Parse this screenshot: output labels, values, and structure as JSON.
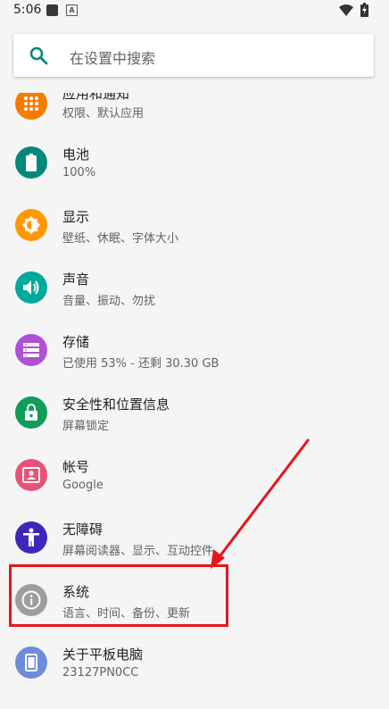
{
  "status": {
    "time": "5:06",
    "a_label": "A"
  },
  "search": {
    "placeholder": "在设置中搜索"
  },
  "items": [
    {
      "title": "应用和通知",
      "sub": "权限、默认应用",
      "color": "#f57c00",
      "icon": "apps-icon"
    },
    {
      "title": "电池",
      "sub": "100%",
      "color": "#00897b",
      "icon": "battery-icon"
    },
    {
      "title": "显示",
      "sub": "壁纸、休眠、字体大小",
      "color": "#ff9800",
      "icon": "brightness-icon"
    },
    {
      "title": "声音",
      "sub": "音量、振动、勿扰",
      "color": "#00a99d",
      "icon": "volume-icon"
    },
    {
      "title": "存储",
      "sub": "已使用 53% - 还剩 30.30 GB",
      "color": "#b04fd6",
      "icon": "storage-icon"
    },
    {
      "title": "安全性和位置信息",
      "sub": "屏幕锁定",
      "color": "#0f9d58",
      "icon": "lock-icon"
    },
    {
      "title": "帐号",
      "sub": "Google",
      "color": "#e8527a",
      "icon": "account-icon"
    },
    {
      "title": "无障碍",
      "sub": "屏幕阅读器、显示、互动控件",
      "color": "#3f28b8",
      "icon": "accessibility-icon"
    },
    {
      "title": "系统",
      "sub": "语言、时间、备份、更新",
      "color": "#9e9e9e",
      "icon": "info-icon"
    },
    {
      "title": "关于平板电脑",
      "sub": "23127PN0CC",
      "color": "#6e8cd8",
      "icon": "tablet-icon"
    }
  ],
  "annotation": {
    "color": "#e4161b"
  }
}
